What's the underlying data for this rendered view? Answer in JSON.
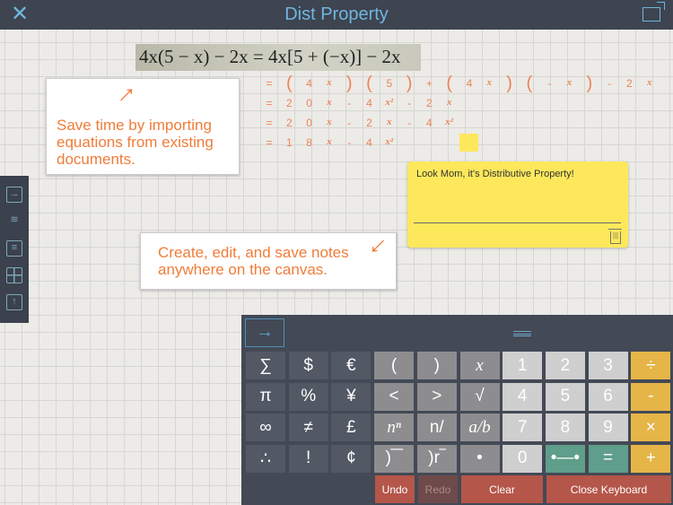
{
  "header": {
    "title": "Dist Property",
    "close_icon": "close-icon",
    "export_icon": "export-icon"
  },
  "imported_equation": "4x(5 − x) − 2x = 4x[5 + (−x)] − 2x",
  "equation_rows": [
    [
      "=",
      "(",
      "4",
      "x",
      ")",
      "(",
      "5",
      ")",
      "+",
      "(",
      "4",
      "x",
      ")",
      "(",
      "-",
      "x",
      ")",
      "-",
      "2",
      "x"
    ],
    [
      "=",
      "2",
      "0",
      "x",
      "-",
      "4",
      "x²",
      "-",
      "2",
      "x"
    ],
    [
      "=",
      "2",
      "0",
      "x",
      "-",
      "2",
      "x",
      "-",
      "4",
      "x²"
    ],
    [
      "=",
      "1",
      "8",
      "x",
      "-",
      "4",
      "x²"
    ]
  ],
  "callouts": {
    "import": "Save time by importing equations from existing documents.",
    "notes": "Create, edit, and save notes anywhere on the canvas."
  },
  "sidebar": [
    "import-icon",
    "layers-icon",
    "note-icon",
    "grid-icon",
    "share-icon"
  ],
  "note": {
    "text": "Look Mom, it's Distributive Property!"
  },
  "keyboard": {
    "tab_arrow": "→",
    "rows": [
      [
        [
          "∑",
          0
        ],
        [
          "$",
          0
        ],
        [
          "€",
          0
        ],
        [
          "(",
          1
        ],
        [
          ")",
          1
        ],
        [
          "x",
          1
        ],
        [
          "1",
          2
        ],
        [
          "2",
          2
        ],
        [
          "3",
          2
        ],
        [
          "÷",
          3
        ]
      ],
      [
        [
          "π",
          0
        ],
        [
          "%",
          0
        ],
        [
          "¥",
          0
        ],
        [
          "<",
          1
        ],
        [
          ">",
          1
        ],
        [
          "√",
          1
        ],
        [
          "4",
          2
        ],
        [
          "5",
          2
        ],
        [
          "6",
          2
        ],
        [
          "-",
          3
        ]
      ],
      [
        [
          "∞",
          0
        ],
        [
          "≠",
          0
        ],
        [
          "£",
          0
        ],
        [
          "nⁿ",
          1
        ],
        [
          "n/",
          1
        ],
        [
          "a/b",
          1
        ],
        [
          "7",
          2
        ],
        [
          "8",
          2
        ],
        [
          "9",
          2
        ],
        [
          "×",
          3
        ]
      ],
      [
        [
          "∴",
          0
        ],
        [
          "!",
          0
        ],
        [
          "¢",
          0
        ],
        [
          ")‾‾",
          1
        ],
        [
          ")r‾",
          1
        ],
        [
          "•",
          1
        ],
        [
          "0",
          2
        ],
        [
          "•—•",
          4
        ],
        [
          "=",
          4
        ],
        [
          "+",
          3
        ]
      ]
    ],
    "undo": "Undo",
    "redo": "Redo",
    "clear": "Clear",
    "close": "Close Keyboard"
  },
  "colors": {
    "accent": "#f07c3a",
    "header": "#3e4450",
    "title": "#6fb6df",
    "note": "#fde85c"
  }
}
